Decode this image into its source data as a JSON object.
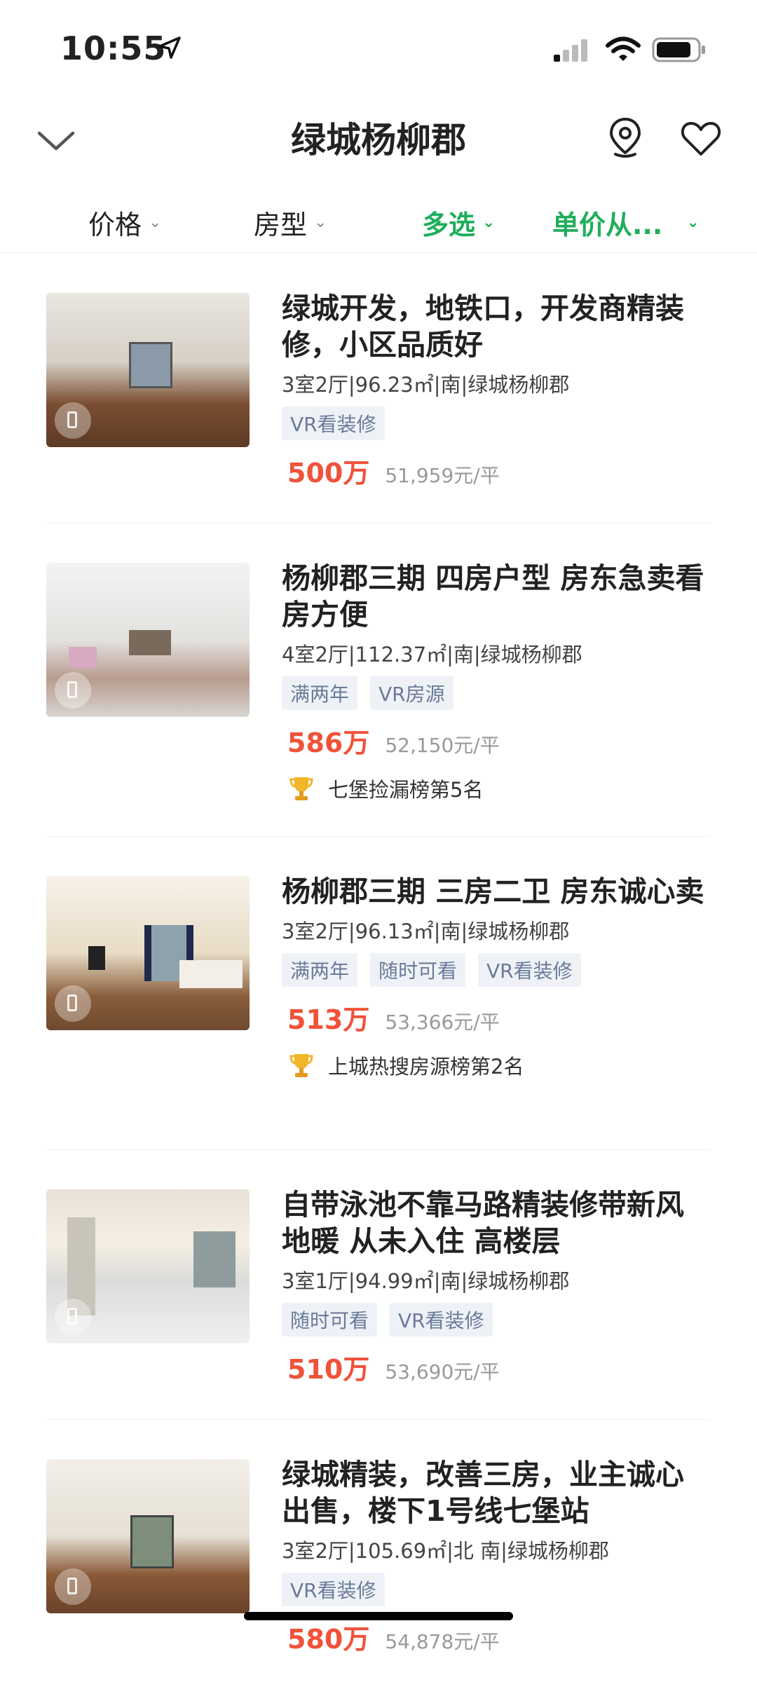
{
  "status": {
    "time": "10:55"
  },
  "nav": {
    "title": "绿城杨柳郡"
  },
  "filters": [
    {
      "label": "价格",
      "active": false
    },
    {
      "label": "房型",
      "active": false
    },
    {
      "label": "多选",
      "active": true
    },
    {
      "label": "单价从...",
      "active": true
    }
  ],
  "listings": [
    {
      "title": "绿城开发，地铁口，开发商精装修，小区品质好",
      "meta": "3室2厅|96.23㎡|南|绿城杨柳郡",
      "tags": [
        "VR看装修"
      ],
      "price": "500万",
      "unit_price": "51,959元/平",
      "rank": ""
    },
    {
      "title": "杨柳郡三期 四房户型 房东急卖看房方便",
      "meta": "4室2厅|112.37㎡|南|绿城杨柳郡",
      "tags": [
        "满两年",
        "VR房源"
      ],
      "price": "586万",
      "unit_price": "52,150元/平",
      "rank": "七堡捡漏榜第5名"
    },
    {
      "title": "杨柳郡三期 三房二卫 房东诚心卖",
      "meta": "3室2厅|96.13㎡|南|绿城杨柳郡",
      "tags": [
        "满两年",
        "随时可看",
        "VR看装修"
      ],
      "price": "513万",
      "unit_price": "53,366元/平",
      "rank": "上城热搜房源榜第2名"
    },
    {
      "title": "自带泳池不靠马路精装修带新风 地暖 从未入住 高楼层",
      "meta": "3室1厅|94.99㎡|南|绿城杨柳郡",
      "tags": [
        "随时可看",
        "VR看装修"
      ],
      "price": "510万",
      "unit_price": "53,690元/平",
      "rank": ""
    },
    {
      "title": "绿城精装，改善三房，业主诚心出售，楼下1号线七堡站",
      "meta": "3室2厅|105.69㎡|北 南|绿城杨柳郡",
      "tags": [
        "VR看装修"
      ],
      "price": "580万",
      "unit_price": "54,878元/平",
      "rank": ""
    }
  ],
  "colors": {
    "accent": "#1fae5b",
    "price": "#f0523a",
    "tag_text": "#6a7b99",
    "tag_bg": "#eef2f7"
  }
}
